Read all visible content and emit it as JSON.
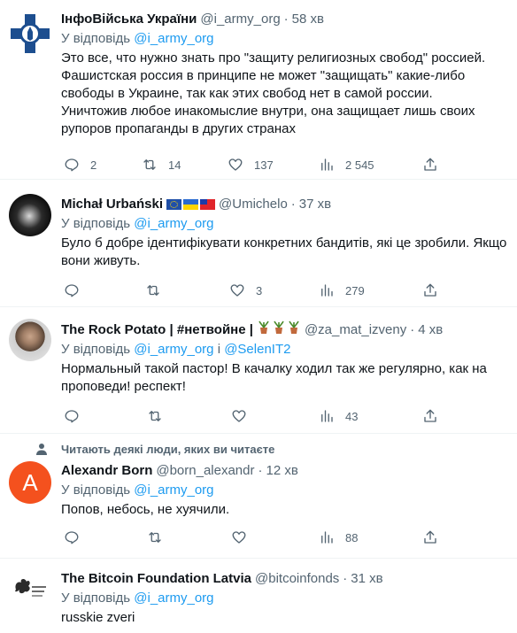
{
  "tweets": [
    {
      "name": "ІнфоВійська України",
      "handle": "@i_army_org",
      "time": "58 хв",
      "reply_prefix": "У відповідь ",
      "reply_to": "@i_army_org",
      "reply_extra": "",
      "text": [
        "Это все, что нужно знать про \"защиту религиозных свобод\" россией.",
        "Фашистская россия в принципе не может \"защищать\" какие-либо",
        "свободы в Украине, так как этих свобод нет в самой россии.",
        "Уничтожив любое инакомыслие внутри, она защищает лишь своих",
        "рупоров пропаганды в других странах"
      ],
      "replies": "2",
      "retweets": "14",
      "likes": "137",
      "views": "2 545"
    },
    {
      "name": "Michał Urbański",
      "handle": "@Umichelo",
      "time": "37 хв",
      "reply_prefix": "У відповідь ",
      "reply_to": "@i_army_org",
      "reply_extra": "",
      "text": [
        "Було б добре ідентифікувати конкретних бандитів, які це зробили. Якщо",
        "вони живуть."
      ],
      "replies": "",
      "retweets": "",
      "likes": "3",
      "views": "279"
    },
    {
      "name": "The Rock Potato | #нетвойне |",
      "handle": "@za_mat_izveny",
      "time": "4 хв",
      "reply_prefix": "У відповідь ",
      "reply_to": "@i_army_org",
      "reply_and": " і ",
      "reply_extra": "@SelenIT2",
      "text": [
        "Нормальный такой пастор! В качалку ходил так же регулярно, как на",
        "проповеди! респект!"
      ],
      "replies": "",
      "retweets": "",
      "likes": "",
      "views": "43"
    },
    {
      "social_context": "Читають деякі люди, яких ви читаєте",
      "avatar_letter": "A",
      "name": "Alexandr Born",
      "handle": "@born_alexandr",
      "time": "12 хв",
      "reply_prefix": "У відповідь ",
      "reply_to": "@i_army_org",
      "reply_extra": "",
      "text": [
        "Попов, небось, не хуячили."
      ],
      "replies": "",
      "retweets": "",
      "likes": "",
      "views": "88"
    },
    {
      "name": "The Bitcoin Foundation Latvia",
      "handle": "@bitcoinfonds",
      "time": "31 хв",
      "reply_prefix": "У відповідь ",
      "reply_to": "@i_army_org",
      "reply_extra": "",
      "text": [
        "russkie zveri"
      ]
    }
  ],
  "icons": {
    "reply": "reply-icon",
    "retweet": "retweet-icon",
    "like": "heart-icon",
    "views": "views-chart-icon",
    "share": "share-icon"
  },
  "colors": {
    "link": "#1d9bf0",
    "secondary": "#536471",
    "text": "#0f1419",
    "divider": "#eff3f4",
    "avatar_orange": "#f4511e"
  }
}
